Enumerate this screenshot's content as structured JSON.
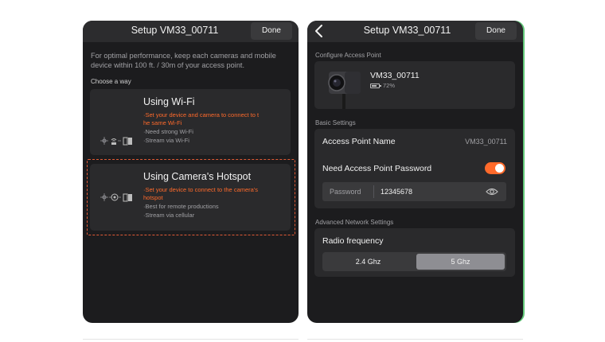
{
  "left_screen": {
    "title": "Setup VM33_00711",
    "done_label": "Done",
    "intro": "For optimal performance, keep each cameras and mobile device within 100 ft. / 30m of your access point.",
    "choose_label": "Choose a way",
    "wifi_option": {
      "title": "Using Wi-Fi",
      "note_line1": "·Set your device and camera to connect to t",
      "note_line2": "he same Wi-Fi",
      "point1": "·Need strong Wi-Fi",
      "point2": "·Stream via Wi-Fi"
    },
    "hotspot_option": {
      "title": "Using Camera's Hotspot",
      "note_line1": "·Set your device to connect to the camera's",
      "note_line2": "hotspot",
      "point1": "·Best for remote productions",
      "point2": "·Stream via cellular"
    }
  },
  "right_screen": {
    "title": "Setup VM33_00711",
    "done_label": "Done",
    "configure_label": "Configure Access Point",
    "device": {
      "name": "VM33_00711",
      "battery": "72%",
      "battery_level": 0.72
    },
    "basic_label": "Basic Settings",
    "ap_name_label": "Access Point Name",
    "ap_name_value": "VM33_00711",
    "need_password_label": "Need Access Point Password",
    "need_password_on": true,
    "password_label": "Password",
    "password_value": "12345678",
    "advanced_label": "Advanced Network Settings",
    "radio_label": "Radio frequency",
    "radio_options": [
      "2.4 Ghz",
      "5 Ghz"
    ],
    "radio_selected": "5 Ghz"
  },
  "colors": {
    "accent": "#ff6a2b",
    "background": "#1c1c1e",
    "card": "#2a2a2c"
  },
  "icons": [
    "chevron-left-icon",
    "eye-icon",
    "battery-icon",
    "camera-icon",
    "wifi-diagram-icon",
    "hotspot-diagram-icon"
  ]
}
